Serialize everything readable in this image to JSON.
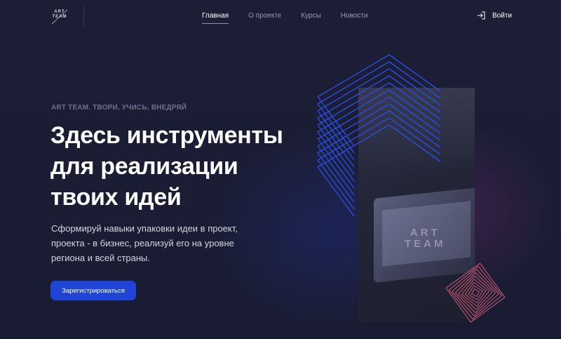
{
  "header": {
    "logo": {
      "line1": "ART",
      "line2": "TEAM"
    },
    "nav": [
      {
        "label": "Главная",
        "active": true
      },
      {
        "label": "О проекте",
        "active": false
      },
      {
        "label": "Курсы",
        "active": false
      },
      {
        "label": "Новости",
        "active": false
      }
    ],
    "login_label": "Войти",
    "login_icon": "login-icon"
  },
  "hero": {
    "tagline": "ART TEAM. ТВОРИ, УЧИСЬ, ВНЕДРЯЙ",
    "headline_lines": [
      "Здесь инструменты",
      "для реализации",
      "твоих идей"
    ],
    "description": "Сформируй навыки упаковки идеи в проект, проекта - в бизнес, реализуй его на уровне региона и всей страны.",
    "cta_label": "Зарегистрироваться"
  },
  "visual": {
    "photo_logo_line1": "ART",
    "photo_logo_line2": "TEAM"
  },
  "colors": {
    "background": "#1b1d35",
    "accent": "#1f44d6",
    "chevron_blue": "#2a4de0",
    "square_pink": "#d05a78"
  }
}
